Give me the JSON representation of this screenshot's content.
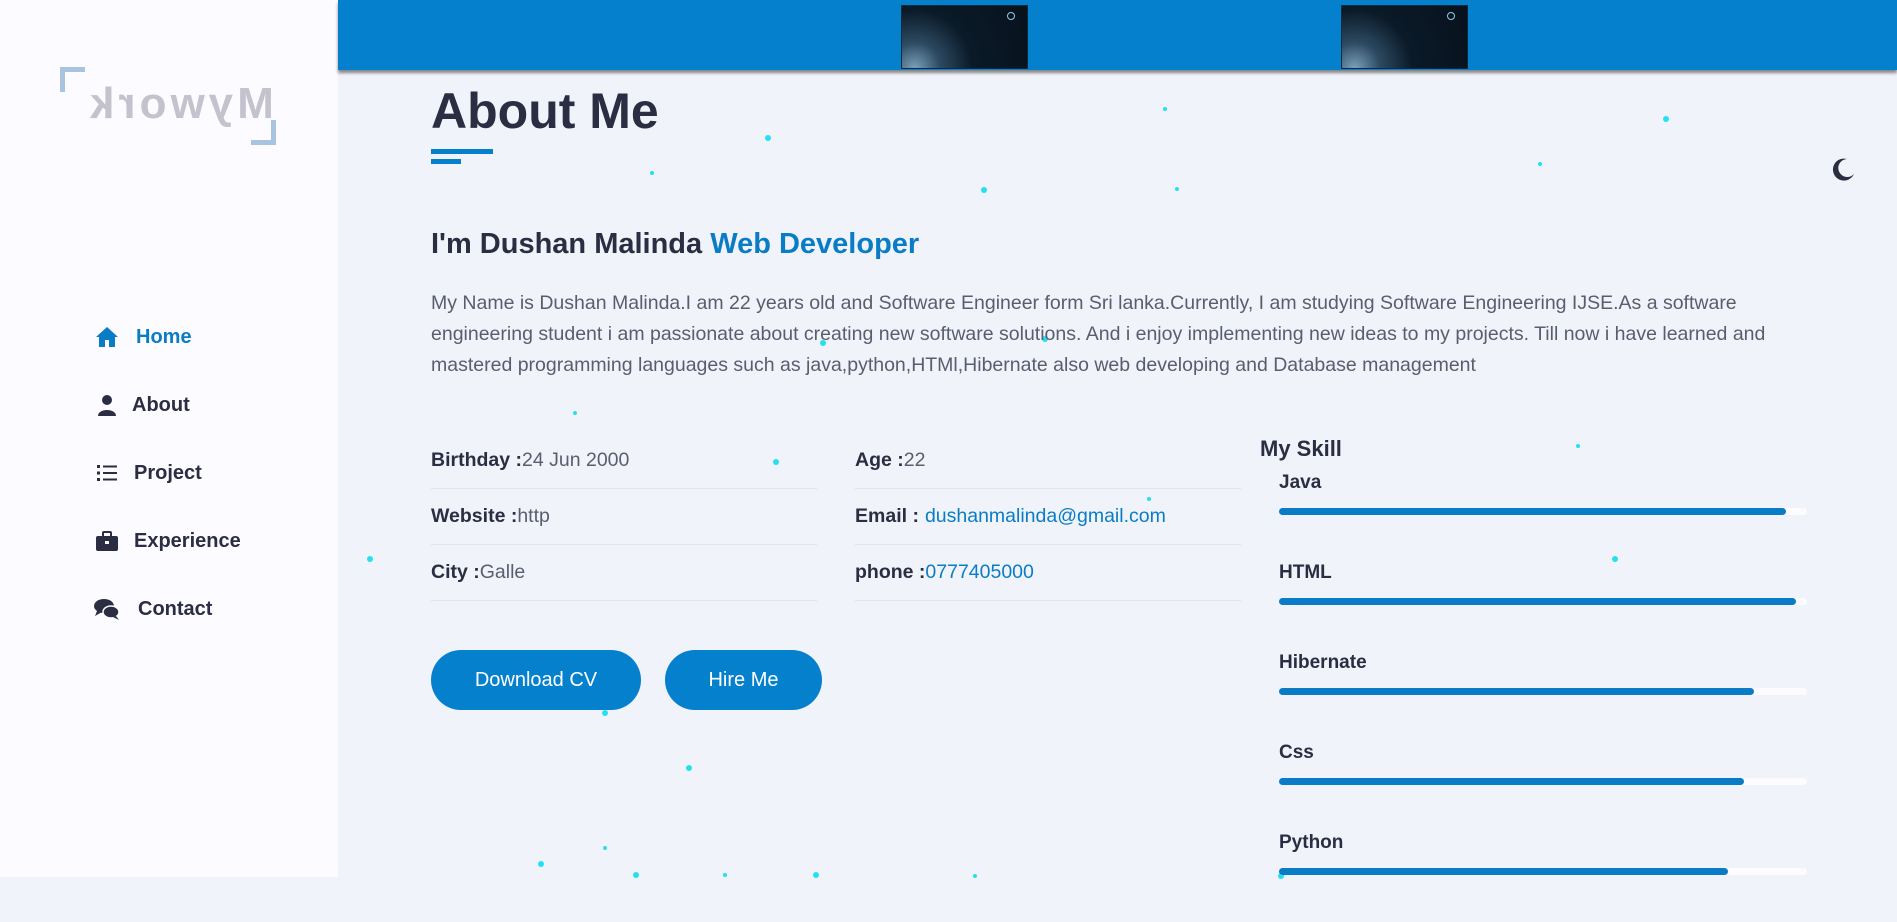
{
  "logo": {
    "text": "Mywork"
  },
  "nav": {
    "items": [
      {
        "label": "Home",
        "icon": "home-icon",
        "active": true
      },
      {
        "label": "About",
        "icon": "user-icon",
        "active": false
      },
      {
        "label": "Project",
        "icon": "list-icon",
        "active": false
      },
      {
        "label": "Experience",
        "icon": "briefcase-icon",
        "active": false
      },
      {
        "label": "Contact",
        "icon": "chat-icon",
        "active": false
      }
    ]
  },
  "header": {
    "theme_icon": "moon-icon"
  },
  "about": {
    "title": "About Me",
    "headline_prefix": "I'm Dushan Malinda",
    "headline_accent": "Web Developer",
    "bio": "My Name is Dushan Malinda.I am 22 years old and Software Engineer form Sri lanka.Currently, I am studying Software Engineering IJSE.As a software engineering student i am passionate about creating new software solutions. And i enjoy implementing new ideas to my projects. Till now i have learned and mastered programming languages such as java,python,HTMl,Hibernate also web developing and Database management"
  },
  "info": {
    "birthday_label": "Birthday :",
    "birthday_value": "24 Jun 2000",
    "website_label": "Website :",
    "website_value": "http",
    "city_label": "City :",
    "city_value": "Galle",
    "age_label": "Age :",
    "age_value": "22",
    "email_label": "Email :",
    "email_value": "dushanmalinda@gmail.com",
    "phone_label": "phone :",
    "phone_value": "0777405000"
  },
  "buttons": {
    "download": "Download CV",
    "hire": "Hire Me"
  },
  "skills": {
    "title": "My Skill",
    "items": [
      {
        "name": "Java",
        "level": 96
      },
      {
        "name": "HTML",
        "level": 98
      },
      {
        "name": "Hibernate",
        "level": 90
      },
      {
        "name": "Css",
        "level": 88
      },
      {
        "name": "Python",
        "level": 85
      }
    ]
  },
  "colors": {
    "accent": "#0480cc",
    "particle": "#25e0f0",
    "sidebar_bg": "#fcfbff",
    "page_bg": "#f1f3fa"
  }
}
